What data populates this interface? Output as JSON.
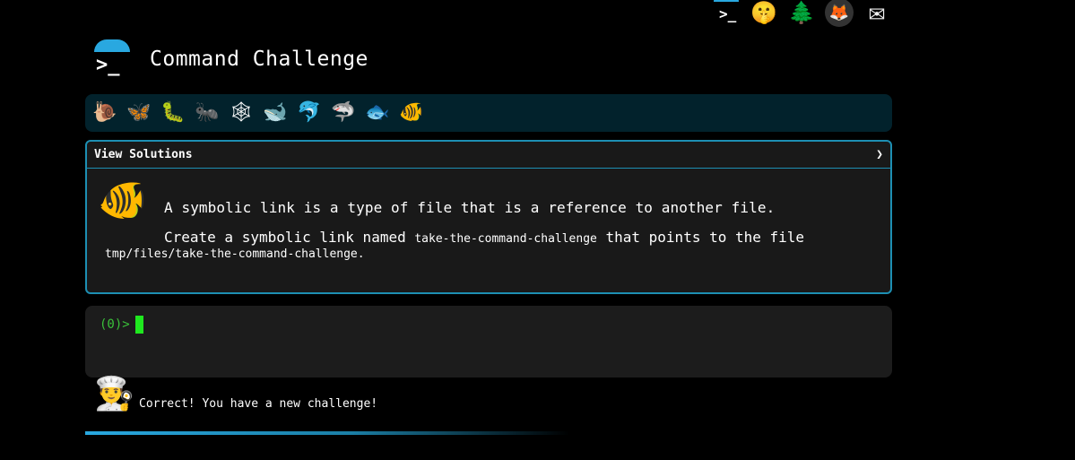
{
  "top_icons": [
    {
      "name": "terminal",
      "glyph": ">_"
    },
    {
      "name": "shush-face",
      "glyph": "🤫"
    },
    {
      "name": "tree",
      "glyph": "🌲"
    },
    {
      "name": "gitlab",
      "glyph": "🦊"
    },
    {
      "name": "mail",
      "glyph": "✉"
    }
  ],
  "header": {
    "logo_glyph": ">_",
    "title": "Command Challenge"
  },
  "levels": [
    {
      "name": "snail",
      "glyph": "🐌"
    },
    {
      "name": "butterfly",
      "glyph": "🦋"
    },
    {
      "name": "caterpillar",
      "glyph": "🐛"
    },
    {
      "name": "ant",
      "glyph": "🐜"
    },
    {
      "name": "spider-web",
      "glyph": "🕸"
    },
    {
      "name": "whale",
      "glyph": "🐋"
    },
    {
      "name": "dolphin-jump",
      "glyph": "🐬"
    },
    {
      "name": "shark",
      "glyph": "🦈"
    },
    {
      "name": "fish",
      "glyph": "🐟"
    },
    {
      "name": "tropical-fish",
      "glyph": "🐠"
    }
  ],
  "panel": {
    "header_label": "View Solutions",
    "chevron": "❯",
    "fish_glyph": "🐠",
    "line1": "A symbolic link is a type of file that is a reference to another file.",
    "line2_prefix": "Create a symbolic link named ",
    "line2_code": "take-the-command-challenge",
    "line2_suffix": " that points to the file",
    "line3": "tmp/files/take-the-command-challenge."
  },
  "terminal": {
    "prompt": "(0)>"
  },
  "status": {
    "chef_glyph": "👨‍🍳",
    "message": "Correct! You have a new challenge!"
  },
  "colors": {
    "accent": "#29a8e0",
    "prompt_green": "#3ac13a",
    "cursor_green": "#1fe81f",
    "panel_border": "#1d8fb3"
  }
}
